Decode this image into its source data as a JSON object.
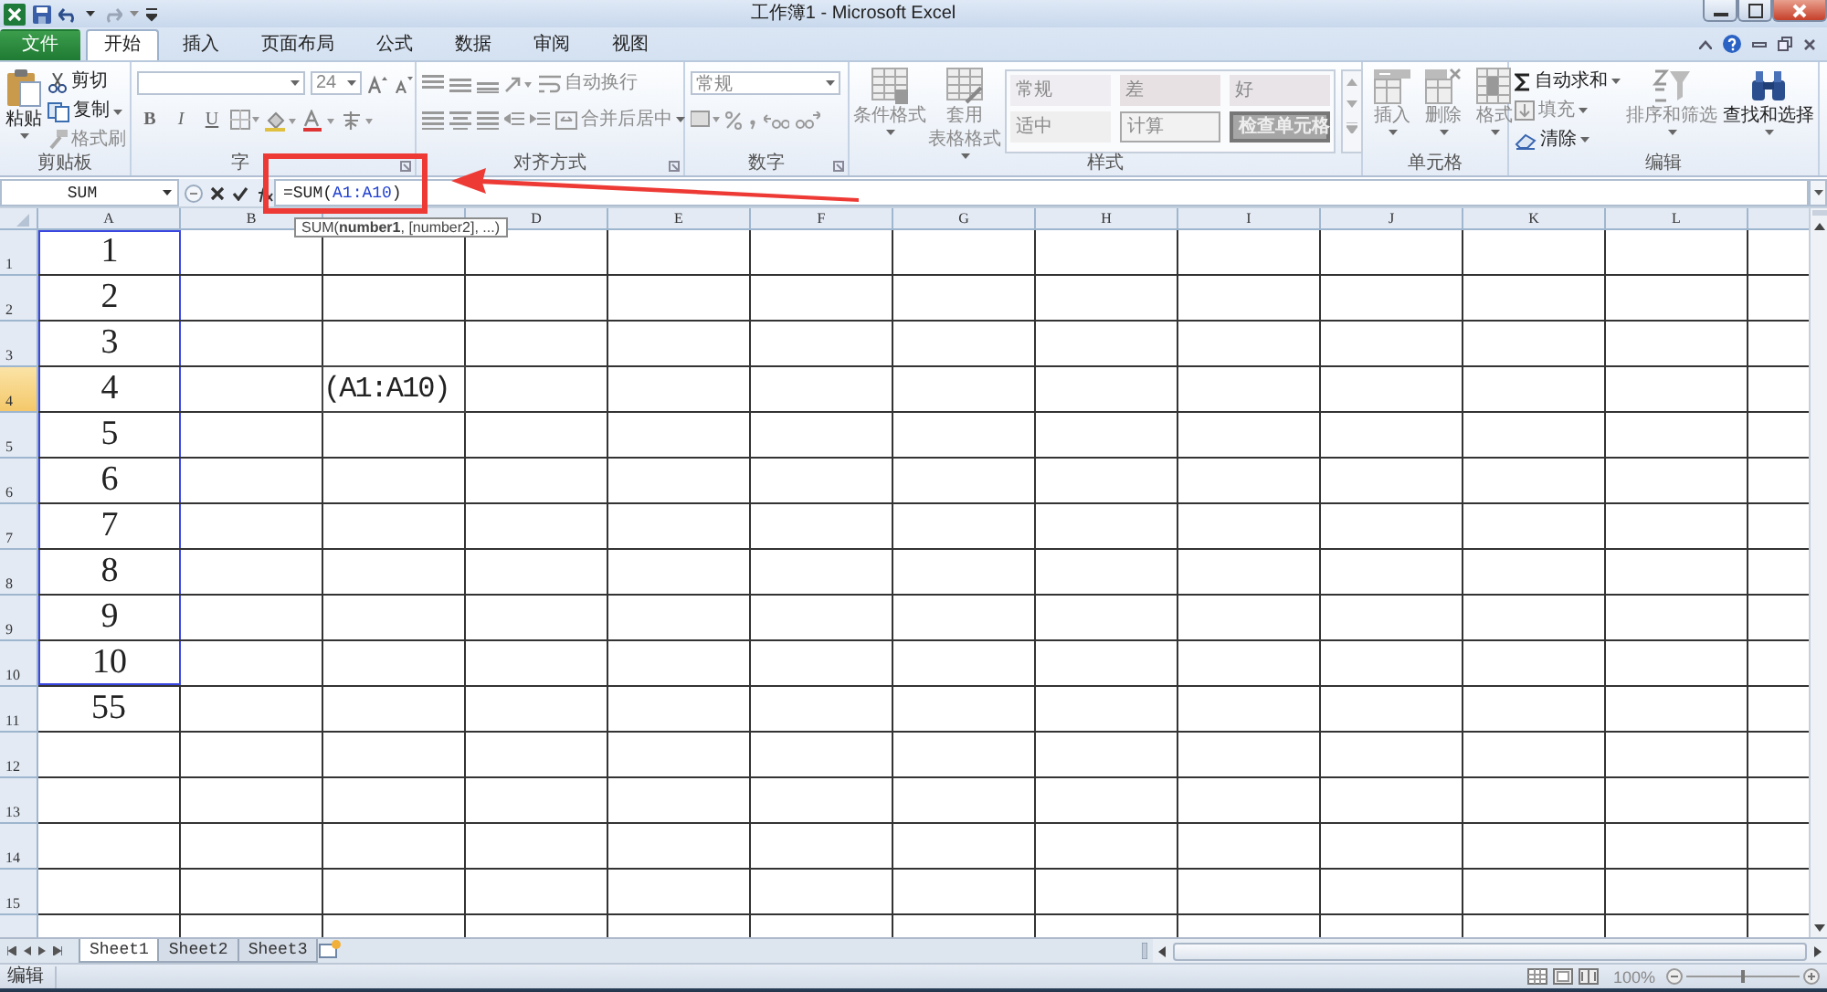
{
  "window": {
    "title": "工作簿1 - Microsoft Excel"
  },
  "ribbon_tabs": [
    {
      "label": "文件",
      "kind": "file",
      "selected": false
    },
    {
      "label": "开始",
      "kind": "tab",
      "selected": true
    },
    {
      "label": "插入",
      "kind": "tab",
      "selected": false
    },
    {
      "label": "页面布局",
      "kind": "tab",
      "selected": false
    },
    {
      "label": "公式",
      "kind": "tab",
      "selected": false
    },
    {
      "label": "数据",
      "kind": "tab",
      "selected": false
    },
    {
      "label": "审阅",
      "kind": "tab",
      "selected": false
    },
    {
      "label": "视图",
      "kind": "tab",
      "selected": false
    }
  ],
  "ribbon_groups": [
    {
      "kind": "clipboard",
      "label": "剪贴板",
      "commands": [
        {
          "label": "粘贴",
          "disabled": false
        },
        {
          "label": "剪切",
          "disabled": false
        },
        {
          "label": "复制",
          "disabled": false
        },
        {
          "label": "格式刷",
          "disabled": true
        }
      ]
    },
    {
      "kind": "font",
      "label": "字",
      "font_size": "24",
      "style_buttons": [
        "B",
        "I",
        "U"
      ]
    },
    {
      "kind": "alignment",
      "label": "对齐方式",
      "commands": [
        {
          "label": "自动换行",
          "disabled": true
        },
        {
          "label": "合并后居中",
          "disabled": true
        }
      ]
    },
    {
      "kind": "number",
      "label": "数字",
      "format": "常规"
    },
    {
      "kind": "styles",
      "label": "样式",
      "commands": [
        {
          "lines": [
            "条件格式"
          ],
          "disabled": true
        },
        {
          "lines": [
            "套用",
            "表格格式"
          ],
          "disabled": true
        }
      ],
      "cell_styles": [
        {
          "label": "常规",
          "kind": "normal"
        },
        {
          "label": "差",
          "kind": "bad"
        },
        {
          "label": "好",
          "kind": "good"
        },
        {
          "label": "适中",
          "kind": "neutral"
        },
        {
          "label": "计算",
          "kind": "calculation"
        },
        {
          "label": "检查单元格",
          "kind": "check"
        }
      ]
    },
    {
      "kind": "cells",
      "label": "单元格",
      "commands": [
        {
          "label": "插入",
          "disabled": true
        },
        {
          "label": "删除",
          "disabled": true
        },
        {
          "label": "格式",
          "disabled": true
        }
      ]
    },
    {
      "kind": "editing",
      "label": "编辑",
      "commands": [
        {
          "label": "自动求和",
          "disabled": false
        },
        {
          "label": "填充",
          "disabled": true
        },
        {
          "label": "清除",
          "disabled": false
        },
        {
          "label": "排序和筛选",
          "disabled": true
        },
        {
          "label": "查找和选择",
          "disabled": false
        }
      ]
    }
  ],
  "formula_bar": {
    "name_box": "SUM",
    "formula": [
      {
        "text": "=SUM(",
        "kind": "text"
      },
      {
        "text": "A1:A10",
        "kind": "reference"
      },
      {
        "text": ")",
        "kind": "text"
      }
    ],
    "tooltip": "SUM(**number1**, [number2], ...)"
  },
  "columns": [
    "A",
    "B",
    null,
    "D",
    "E",
    "F",
    "G",
    "H",
    "I",
    "J",
    "K",
    "L"
  ],
  "rows": [
    {
      "label": "1",
      "selected": false,
      "referenced": true,
      "cells": [
        "1"
      ]
    },
    {
      "label": "2",
      "selected": false,
      "referenced": true,
      "cells": [
        "2"
      ]
    },
    {
      "label": "3",
      "selected": false,
      "referenced": true,
      "cells": [
        "3"
      ]
    },
    {
      "label": "4",
      "selected": true,
      "referenced": true,
      "cells": [
        "4",
        null,
        "(A1:A10)"
      ]
    },
    {
      "label": "5",
      "selected": false,
      "referenced": true,
      "cells": [
        "5"
      ]
    },
    {
      "label": "6",
      "selected": false,
      "referenced": true,
      "cells": [
        "6"
      ]
    },
    {
      "label": "7",
      "selected": false,
      "referenced": true,
      "cells": [
        "7"
      ]
    },
    {
      "label": "8",
      "selected": false,
      "referenced": true,
      "cells": [
        "8"
      ]
    },
    {
      "label": "9",
      "selected": false,
      "referenced": true,
      "cells": [
        "9"
      ]
    },
    {
      "label": "10",
      "selected": false,
      "referenced": true,
      "cells": [
        "10"
      ]
    },
    {
      "label": "11",
      "selected": false,
      "referenced": false,
      "cells": [
        "55"
      ]
    },
    {
      "label": "12",
      "selected": false,
      "cells": []
    },
    {
      "label": "13",
      "selected": false,
      "cells": []
    },
    {
      "label": "14",
      "selected": false,
      "cells": []
    },
    {
      "label": "15",
      "selected": false,
      "cells": []
    }
  ],
  "sheets": [
    {
      "label": "Sheet1",
      "selected": true
    },
    {
      "label": "Sheet2",
      "selected": false
    },
    {
      "label": "Sheet3",
      "selected": false
    }
  ],
  "status_bar": {
    "mode": "编辑",
    "zoom": "100%",
    "zoom_slider": {
      "level": 0.5
    }
  }
}
